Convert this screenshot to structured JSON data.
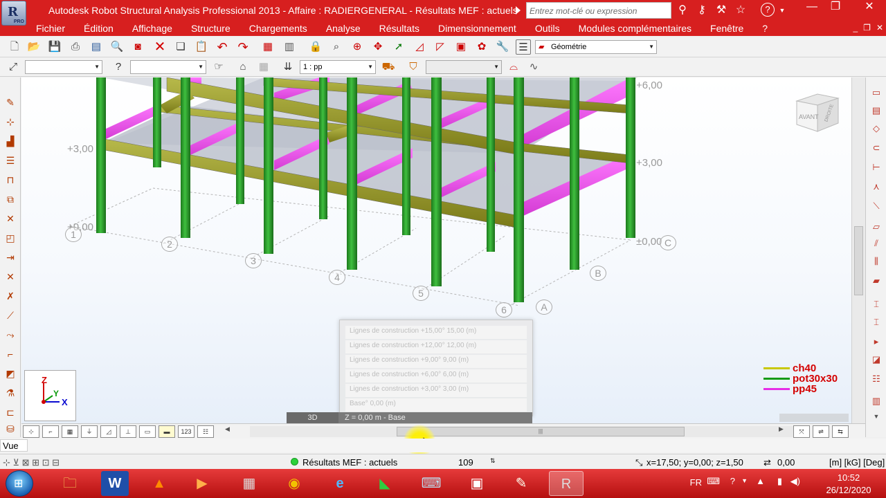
{
  "titlebar": {
    "title": "Autodesk Robot Structural Analysis Professional 2013 - Affaire : RADIERGENERAL - Résultats MEF : actuels",
    "app_icon_letter": "R",
    "app_icon_tag": "PRO",
    "search_placeholder": "Entrez mot-clé ou expression",
    "help_label": "?",
    "minimize": "—",
    "restore": "❐",
    "close": "✕"
  },
  "menu": {
    "items": [
      "Fichier",
      "Édition",
      "Affichage",
      "Structure",
      "Chargements",
      "Analyse",
      "Résultats",
      "Dimensionnement",
      "Outils",
      "Modules complémentaires",
      "Fenêtre",
      "?"
    ]
  },
  "toolbar1": {
    "layout_combo": "Géométrie"
  },
  "toolbar2": {
    "case_combo": "1 : pp"
  },
  "viewport": {
    "levels": [
      "+6,00",
      "+3,00",
      "+0,00",
      "+3,00",
      "±0,00"
    ],
    "axis_numbers": [
      "1",
      "2",
      "3",
      "4",
      "5",
      "6"
    ],
    "axis_letters": [
      "A",
      "B",
      "C"
    ],
    "viewcube_front": "AVANT",
    "viewcube_right": "DROITE",
    "axes": {
      "z": "Z",
      "y": "Y",
      "x": "X"
    },
    "legend": [
      {
        "name": "ch40",
        "color": "#c8c800"
      },
      {
        "name": "pot30x30",
        "color": "#169a16"
      },
      {
        "name": "pp45",
        "color": "#e62de6"
      }
    ],
    "popup_items": [
      "Lignes de construction +15,00° 15,00 (m)",
      "Lignes de construction +12,00° 12,00 (m)",
      "Lignes de construction +9,00° 9,00 (m)",
      "Lignes de construction +6,00° 6,00 (m)",
      "Lignes de construction +3,00° 3,00 (m)",
      "Base° 0,00 (m)"
    ],
    "tab_3d": "3D",
    "tab_z": "Z = 0,00 m - Base"
  },
  "vue_field": "Vue",
  "status": {
    "results": "Résultats MEF : actuels",
    "count": "109",
    "coords": "x=17,50; y=0,00; z=1,50",
    "angle": "0,00",
    "units": "[m] [kG] [Deg]"
  },
  "taskbar": {
    "lang": "FR",
    "time": "10:52",
    "date": "26/12/2020"
  }
}
